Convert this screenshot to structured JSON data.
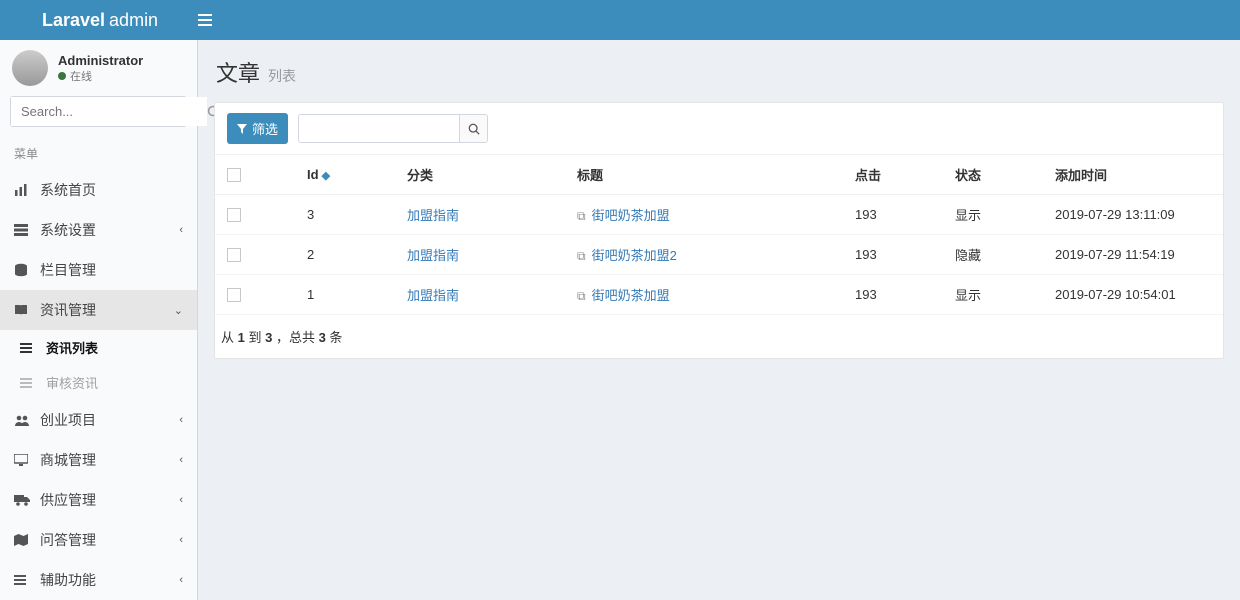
{
  "header": {
    "logo_bold": "Laravel",
    "logo_light": "admin"
  },
  "user": {
    "name": "Administrator",
    "status": "在线"
  },
  "search": {
    "placeholder": "Search..."
  },
  "menu_header": "菜单",
  "nav": {
    "home": "系统首页",
    "settings": "系统设置",
    "columns": "栏目管理",
    "news": "资讯管理",
    "news_list": "资讯列表",
    "news_review": "审核资讯",
    "startup": "创业项目",
    "mall": "商城管理",
    "supply": "供应管理",
    "qa": "问答管理",
    "aux": "辅助功能"
  },
  "page": {
    "title": "文章",
    "subtitle": "列表"
  },
  "toolbar": {
    "filter": "筛选",
    "search_value": ""
  },
  "table": {
    "headers": {
      "id": "Id",
      "category": "分类",
      "title": "标题",
      "hits": "点击",
      "status": "状态",
      "created": "添加时间"
    },
    "rows": [
      {
        "id": "3",
        "category": "加盟指南",
        "title": "街吧奶茶加盟",
        "hits": "193",
        "status": "显示",
        "created": "2019-07-29 13:11:09"
      },
      {
        "id": "2",
        "category": "加盟指南",
        "title": "街吧奶茶加盟2",
        "hits": "193",
        "status": "隐藏",
        "created": "2019-07-29 11:54:19"
      },
      {
        "id": "1",
        "category": "加盟指南",
        "title": "街吧奶茶加盟",
        "hits": "193",
        "status": "显示",
        "created": "2019-07-29 10:54:01"
      }
    ]
  },
  "pagination": {
    "from": "1",
    "to": "3",
    "total": "3",
    "tpl_a": "从 ",
    "tpl_b": " 到 ",
    "tpl_c": " ，总共 ",
    "tpl_d": " 条"
  }
}
